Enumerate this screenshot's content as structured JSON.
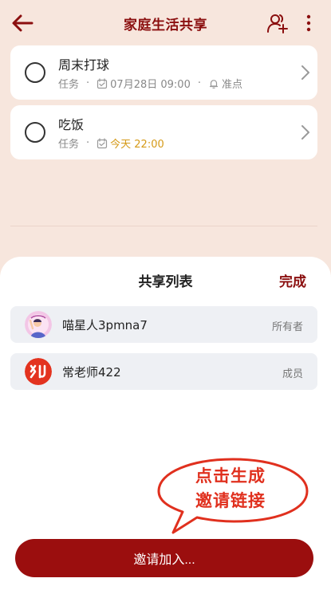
{
  "header": {
    "title": "家庭生活共享",
    "back_icon": "arrow-left-icon",
    "share_icon": "add-person-icon",
    "more_icon": "vertical-dots-icon"
  },
  "tasks": [
    {
      "name": "周末打球",
      "type": "任务",
      "date": "07月28日 09:00",
      "reminder": "准点"
    },
    {
      "name": "吃饭",
      "type": "任务",
      "date": "今天 22:00"
    }
  ],
  "sheet": {
    "title": "共享列表",
    "done_label": "完成",
    "members": [
      {
        "name": "喵星人3pmna7",
        "role": "所有者",
        "avatar": "cartoon-avatar"
      },
      {
        "name": "常老师422",
        "role": "成员",
        "avatar": "red-logo-avatar"
      }
    ]
  },
  "annotation": {
    "line1": "点击生成",
    "line2": "邀请链接"
  },
  "invite_button_label": "邀请加入...",
  "colors": {
    "accent": "#8b0f0f",
    "button": "#9b0e0e",
    "background": "#f7e6dd",
    "today": "#d59a18",
    "annotation": "#e0301e"
  }
}
